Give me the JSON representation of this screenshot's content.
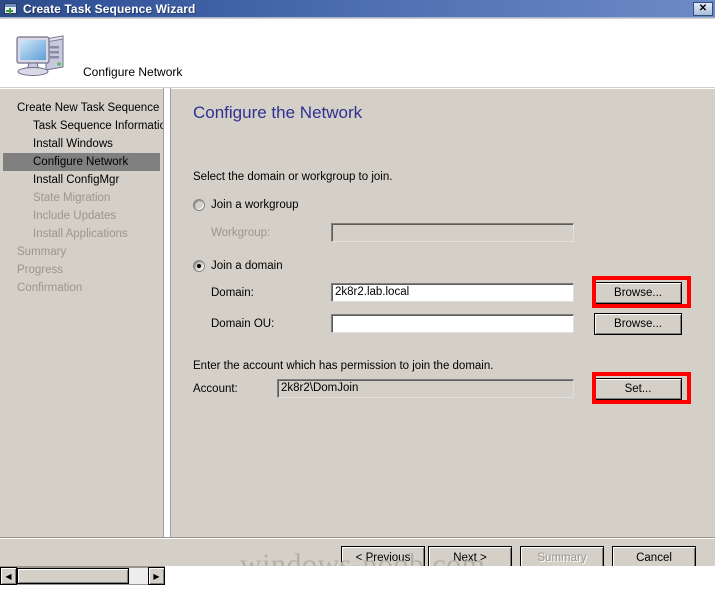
{
  "window": {
    "title": "Create Task Sequence Wizard",
    "title_icon": "new-form-icon",
    "close_label": "✕"
  },
  "header": {
    "icon": "computer-icon",
    "title": "Configure Network"
  },
  "sidebar": {
    "items": [
      {
        "label": "Create New Task Sequence",
        "level": 0,
        "state": "normal"
      },
      {
        "label": "Task Sequence Informatio",
        "level": 1,
        "state": "normal"
      },
      {
        "label": "Install Windows",
        "level": 1,
        "state": "normal"
      },
      {
        "label": "Configure Network",
        "level": 1,
        "state": "selected"
      },
      {
        "label": "Install ConfigMgr",
        "level": 1,
        "state": "normal"
      },
      {
        "label": "State Migration",
        "level": 1,
        "state": "disabled"
      },
      {
        "label": "Include Updates",
        "level": 1,
        "state": "disabled"
      },
      {
        "label": "Install Applications",
        "level": 1,
        "state": "disabled"
      },
      {
        "label": "Summary",
        "level": 0,
        "state": "disabled"
      },
      {
        "label": "Progress",
        "level": 0,
        "state": "disabled"
      },
      {
        "label": "Confirmation",
        "level": 0,
        "state": "disabled"
      }
    ]
  },
  "content": {
    "heading": "Configure the Network",
    "instruction_domain": "Select the domain or workgroup to join.",
    "instruction_account": "Enter the account which has permission to join the domain.",
    "workgroup_option": {
      "label": "Join a workgroup",
      "selected": false,
      "field_label": "Workgroup:",
      "field_value": "",
      "field_enabled": false
    },
    "domain_option": {
      "label": "Join a domain",
      "selected": true,
      "domain_label": "Domain:",
      "domain_value": "2k8r2.lab.local",
      "domain_browse_label": "Browse...",
      "domain_ou_label": "Domain OU:",
      "domain_ou_value": "",
      "domain_ou_browse_label": "Browse..."
    },
    "account": {
      "label": "Account:",
      "value": "2k8r2\\DomJoin",
      "set_label": "Set..."
    }
  },
  "annotations": {
    "color": "#ff0000",
    "highlighted": [
      "domain-browse-button",
      "account-set-button"
    ]
  },
  "footer": {
    "previous_label": "< Previous",
    "next_label": "Next >",
    "summary_label": "Summary",
    "summary_enabled": false,
    "cancel_label": "Cancel"
  },
  "watermark": "windows-noob.com",
  "scrollbar": {
    "left_arrow": "◀",
    "right_arrow": "▶"
  }
}
